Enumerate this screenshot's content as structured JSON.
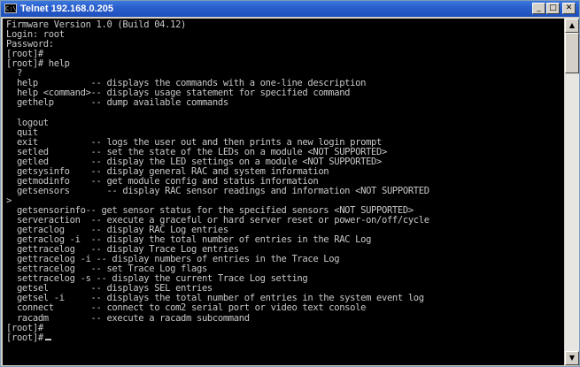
{
  "window": {
    "title": "Telnet 192.168.0.205",
    "icon": "console-window-icon",
    "icon_glyph": "C:\\",
    "buttons": {
      "minimize": "_",
      "maximize": "□",
      "close": "✕"
    }
  },
  "console": {
    "lines": [
      "Firmware Version 1.0 (Build 04.12)",
      "Login: root",
      "Password:",
      "[root]#",
      "[root]# help",
      "  ?",
      "  help          -- displays the commands with a one-line description",
      "  help <command>-- displays usage statement for specified command",
      "  gethelp       -- dump available commands",
      "",
      "  logout",
      "  quit",
      "  exit          -- logs the user out and then prints a new login prompt",
      "  setled        -- set the state of the LEDs on a module <NOT SUPPORTED>",
      "  getled        -- display the LED settings on a module <NOT SUPPORTED>",
      "  getsysinfo    -- display general RAC and system information",
      "  getmodinfo    -- get module config and status information",
      "  getsensors       -- display RAC sensor readings and information <NOT SUPPORTED",
      ">",
      "  getsensorinfo-- get sensor status for the specified sensors <NOT SUPPORTED>",
      "  serveraction  -- execute a graceful or hard server reset or power-on/off/cycle",
      "  getraclog     -- display RAC Log entries",
      "  getraclog -i  -- display the total number of entries in the RAC Log",
      "  gettracelog   -- display Trace Log entries",
      "  gettracelog -i -- display numbers of entries in the Trace Log",
      "  settracelog   -- set Trace Log flags",
      "  settracelog -s -- display the current Trace Log setting",
      "  getsel        -- displays SEL entries",
      "  getsel -i     -- displays the total number of entries in the system event log",
      "  connect       -- connect to com2 serial port or video text console",
      "  racadm        -- execute a racadm subcommand",
      "[root]#",
      "[root]#"
    ]
  },
  "scrollbar": {
    "up_glyph": "▲",
    "down_glyph": "▼"
  }
}
